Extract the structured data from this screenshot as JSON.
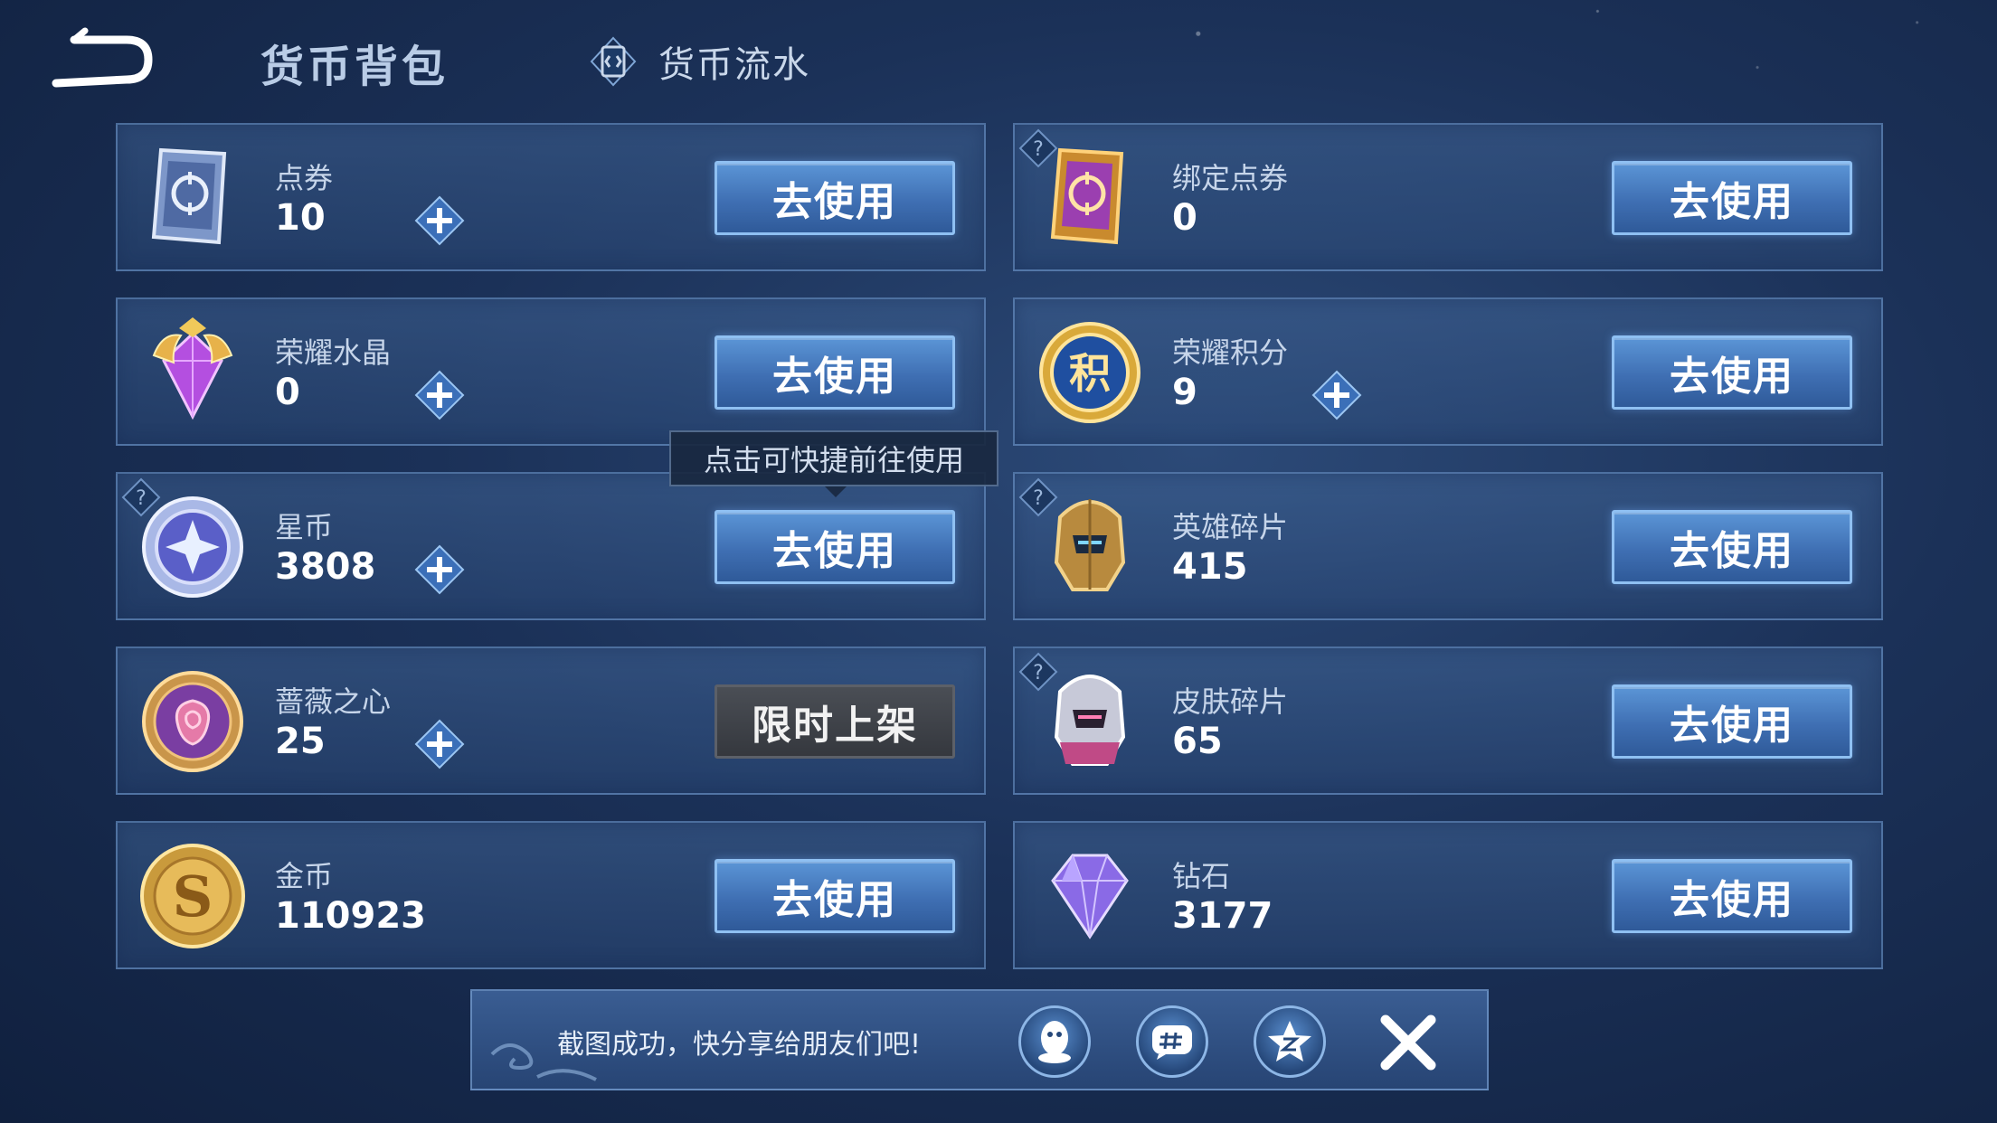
{
  "header": {
    "title": "货币背包",
    "ledger_tab": "货币流水"
  },
  "currencies": [
    {
      "name": "点券",
      "value": "10",
      "button": "去使用",
      "has_plus": true,
      "has_help": false,
      "icon": "coupon-ticket-icon"
    },
    {
      "name": "绑定点券",
      "value": "0",
      "button": "去使用",
      "has_plus": false,
      "has_help": true,
      "icon": "bound-coupon-ticket-icon"
    },
    {
      "name": "荣耀水晶",
      "value": "0",
      "button": "去使用",
      "has_plus": true,
      "has_help": false,
      "icon": "glory-crystal-icon"
    },
    {
      "name": "荣耀积分",
      "value": "9",
      "button": "去使用",
      "has_plus": true,
      "has_help": false,
      "icon": "glory-points-icon"
    },
    {
      "name": "星币",
      "value": "3808",
      "button": "去使用",
      "has_plus": true,
      "has_help": true,
      "icon": "star-coin-icon"
    },
    {
      "name": "英雄碎片",
      "value": "415",
      "button": "去使用",
      "has_plus": false,
      "has_help": true,
      "icon": "hero-fragment-icon"
    },
    {
      "name": "蔷薇之心",
      "value": "25",
      "button": "限时上架",
      "has_plus": true,
      "has_help": false,
      "icon": "rose-heart-icon"
    },
    {
      "name": "皮肤碎片",
      "value": "65",
      "button": "去使用",
      "has_plus": false,
      "has_help": true,
      "icon": "skin-fragment-icon"
    },
    {
      "name": "金币",
      "value": "110923",
      "button": "去使用",
      "has_plus": false,
      "has_help": false,
      "icon": "gold-coin-icon"
    },
    {
      "name": "钻石",
      "value": "3177",
      "button": "去使用",
      "has_plus": false,
      "has_help": false,
      "icon": "diamond-icon"
    }
  ],
  "tooltip": "点击可快捷前往使用",
  "share": {
    "message": "截图成功，快分享给朋友们吧!",
    "targets": [
      "qq-icon",
      "wechat-moments-icon",
      "qzone-icon"
    ]
  },
  "colors": {
    "button_blue": "#3f6fb3",
    "button_disabled": "#35383e",
    "panel": "#2a4876"
  }
}
